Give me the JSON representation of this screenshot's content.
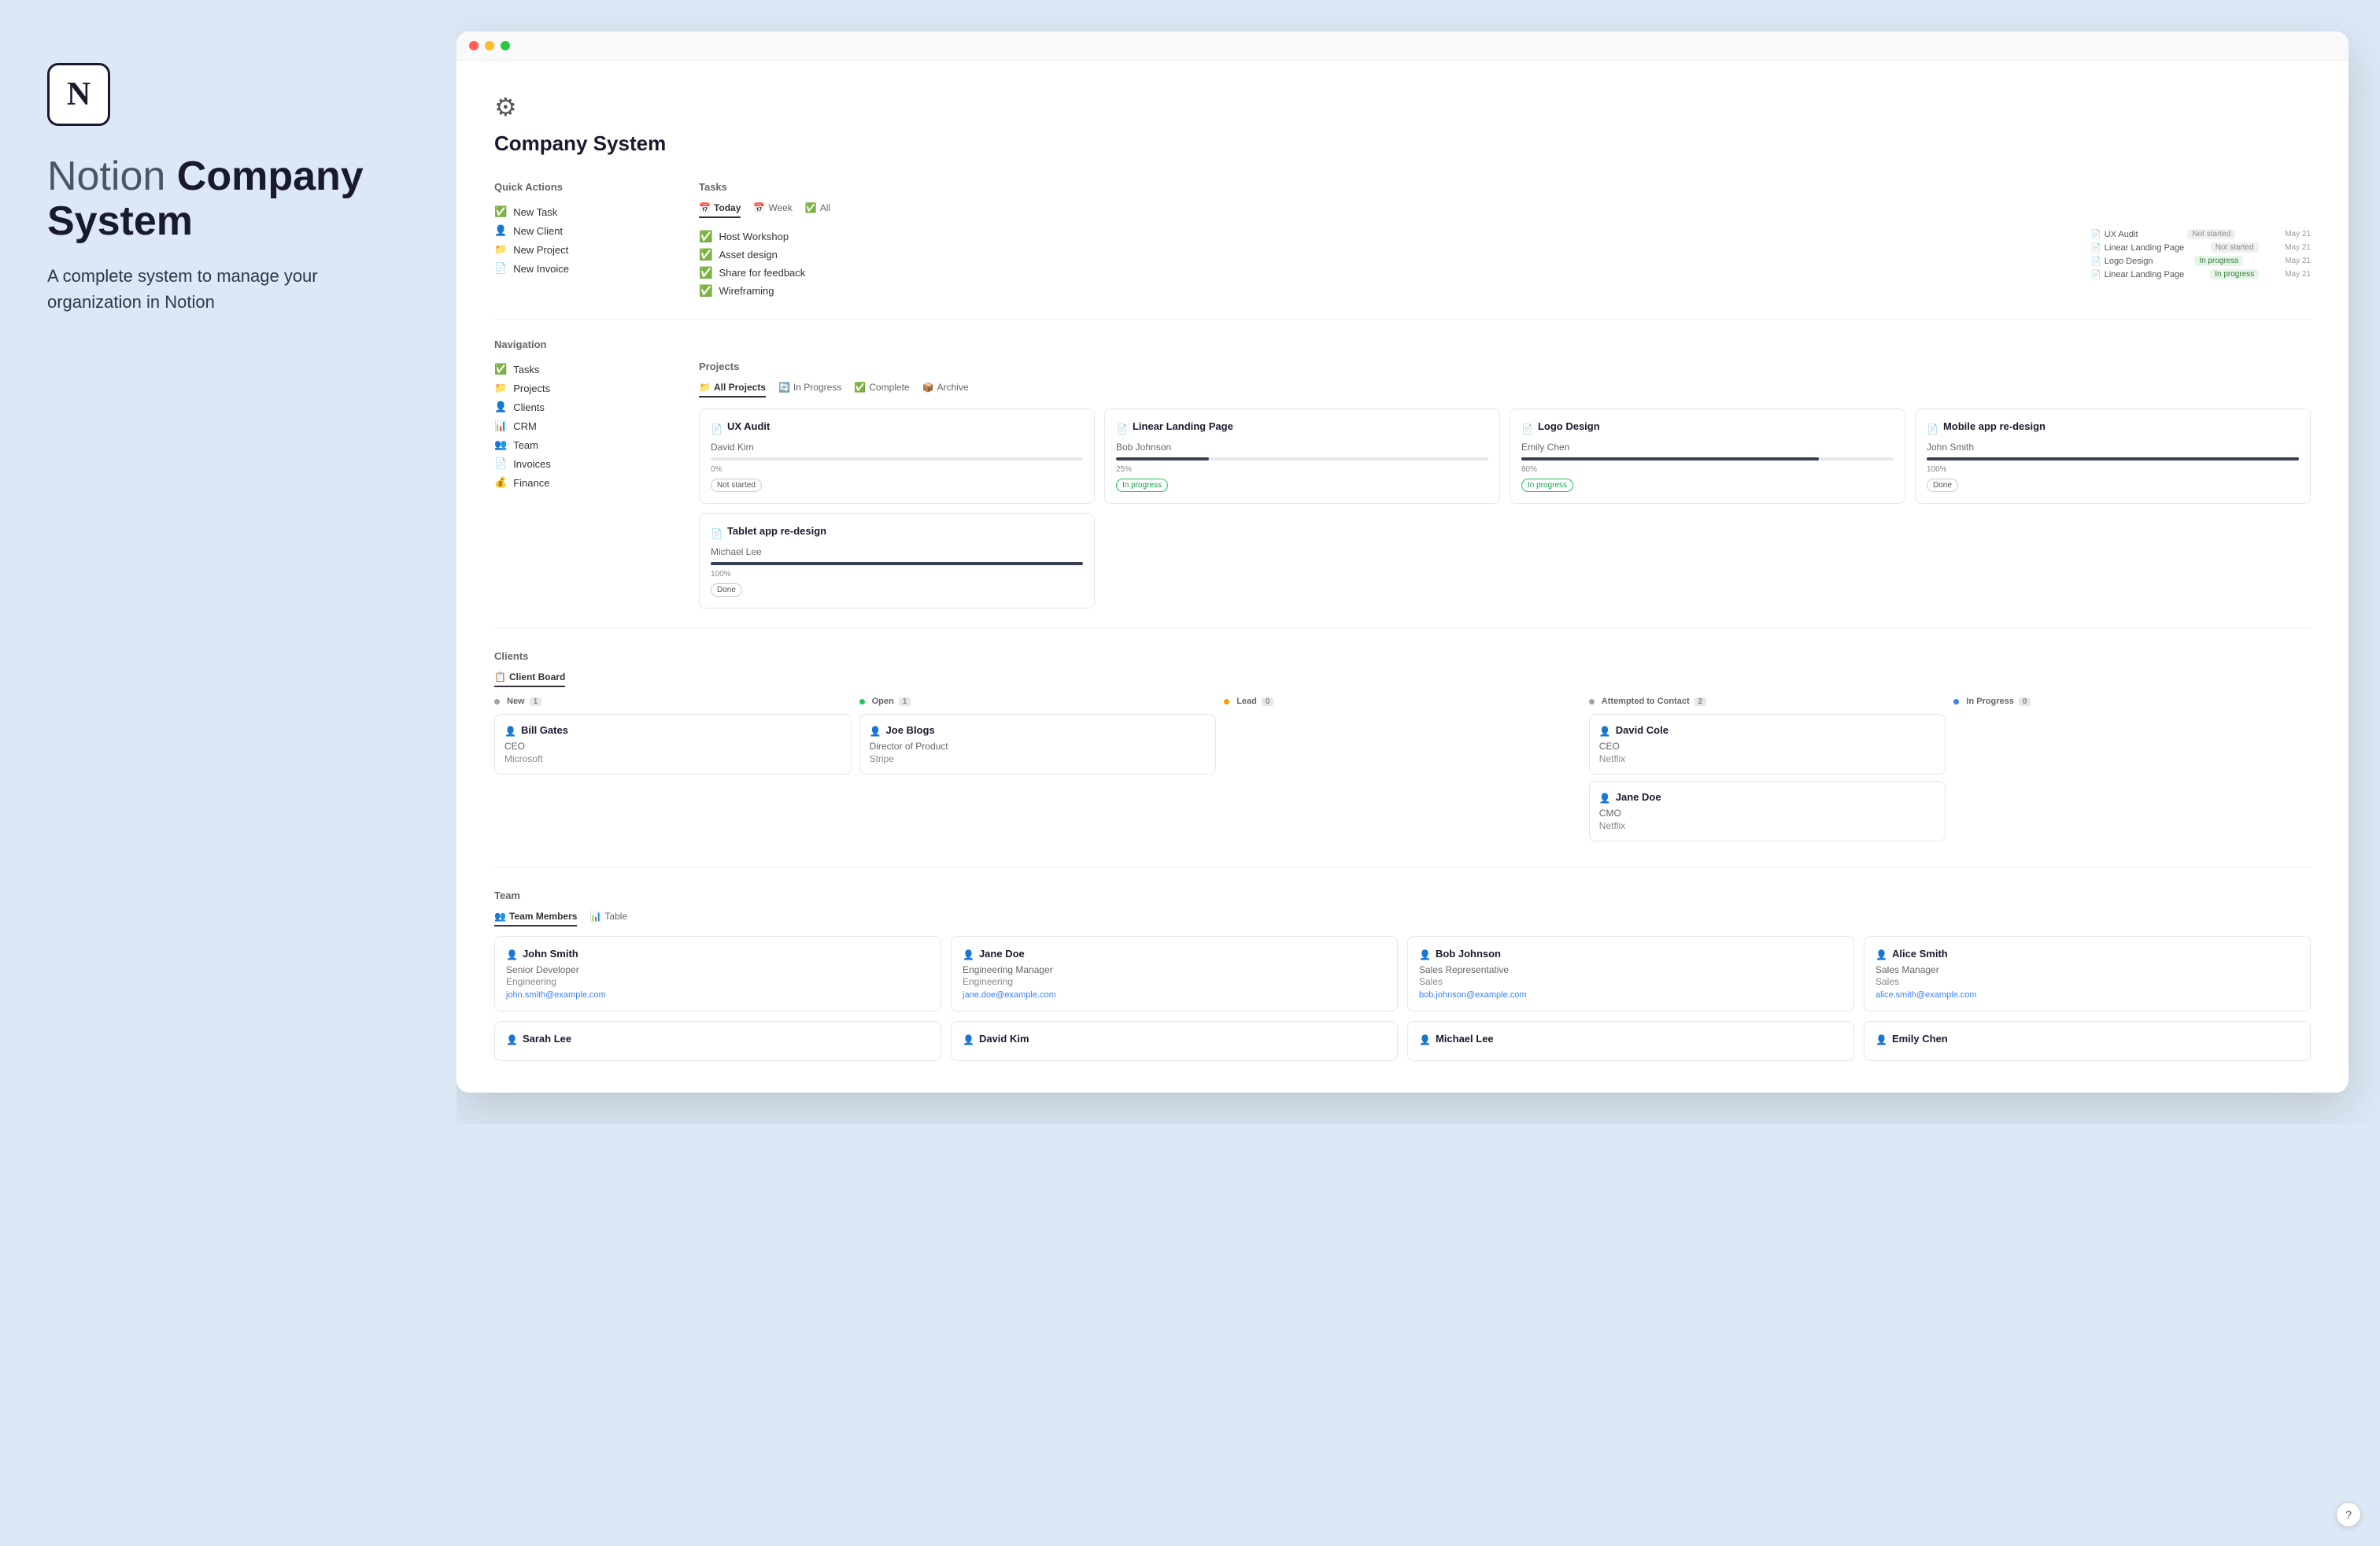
{
  "left": {
    "title_part1": "Notion",
    "title_part2": "Company System",
    "subtitle": "A complete system to manage your organization in Notion"
  },
  "page": {
    "title": "Company System",
    "gear_icon": "⚙"
  },
  "quick_actions": {
    "label": "Quick Actions",
    "items": [
      {
        "icon": "✅",
        "label": "New Task"
      },
      {
        "icon": "👤",
        "label": "New Client"
      },
      {
        "icon": "📁",
        "label": "New Project"
      },
      {
        "icon": "📄",
        "label": "New Invoice"
      }
    ]
  },
  "tasks": {
    "label": "Tasks",
    "tabs": [
      {
        "icon": "📅",
        "label": "Today",
        "active": true
      },
      {
        "icon": "📅",
        "label": "Week",
        "active": false
      },
      {
        "icon": "✅",
        "label": "All",
        "active": false
      }
    ],
    "items": [
      {
        "label": "Host Workshop",
        "checked": true
      },
      {
        "label": "Asset design",
        "checked": true
      },
      {
        "label": "Share for feedback",
        "checked": true
      },
      {
        "label": "Wireframing",
        "checked": true
      }
    ],
    "sidebar_items": [
      {
        "project": "UX Audit",
        "status": "Not started",
        "date": "May 21"
      },
      {
        "project": "Linear Landing Page",
        "status": "Not started",
        "date": "May 21"
      },
      {
        "project": "Logo Design",
        "status": "In progress",
        "date": "May 21"
      },
      {
        "project": "Linear Landing Page",
        "status": "In progress",
        "date": "May 21"
      }
    ]
  },
  "navigation": {
    "label": "Navigation",
    "items": [
      {
        "icon": "✅",
        "label": "Tasks"
      },
      {
        "icon": "📁",
        "label": "Projects"
      },
      {
        "icon": "👤",
        "label": "Clients"
      },
      {
        "icon": "📊",
        "label": "CRM"
      },
      {
        "icon": "👥",
        "label": "Team"
      },
      {
        "icon": "📄",
        "label": "Invoices"
      },
      {
        "icon": "💰",
        "label": "Finance"
      }
    ]
  },
  "projects": {
    "label": "Projects",
    "tabs": [
      {
        "icon": "📁",
        "label": "All Projects",
        "active": true
      },
      {
        "icon": "🔄",
        "label": "In Progress",
        "active": false
      },
      {
        "icon": "✅",
        "label": "Complete",
        "active": false
      },
      {
        "icon": "📦",
        "label": "Archive",
        "active": false
      }
    ],
    "items": [
      {
        "title": "UX Audit",
        "person": "David Kim",
        "progress": 0,
        "status": "Not started",
        "status_type": "notstarted"
      },
      {
        "title": "Linear Landing Page",
        "person": "Bob Johnson",
        "progress": 25,
        "status": "In progress",
        "status_type": "inprogress"
      },
      {
        "title": "Logo Design",
        "person": "Emily Chen",
        "progress": 80,
        "status": "In progress",
        "status_type": "inprogress"
      },
      {
        "title": "Mobile app re-design",
        "person": "John Smith",
        "progress": 100,
        "status": "Done",
        "status_type": "done"
      }
    ],
    "extra_items": [
      {
        "title": "Tablet app re-design",
        "person": "Michael Lee",
        "progress": 100,
        "status": "Done",
        "status_type": "done"
      }
    ]
  },
  "clients": {
    "label": "Clients",
    "tabs": [
      {
        "icon": "📋",
        "label": "Client Board",
        "active": true
      }
    ],
    "columns": [
      {
        "label": "New",
        "count": 1,
        "dot_color": "gray",
        "cards": [
          {
            "name": "Bill Gates",
            "role": "CEO",
            "company": "Microsoft"
          }
        ]
      },
      {
        "label": "Open",
        "count": 1,
        "dot_color": "green",
        "cards": [
          {
            "name": "Joe Blogs",
            "role": "Director of Product",
            "company": "Stripe"
          }
        ]
      },
      {
        "label": "Lead",
        "count": 0,
        "dot_color": "orange",
        "cards": []
      },
      {
        "label": "Attempted to Contact",
        "count": 2,
        "dot_color": "gray",
        "cards": [
          {
            "name": "David Cole",
            "role": "CEO",
            "company": "Netflix"
          },
          {
            "name": "Jane Doe",
            "role": "CMO",
            "company": "Netflix"
          }
        ]
      },
      {
        "label": "In Progress",
        "count": 0,
        "dot_color": "blue",
        "cards": []
      }
    ]
  },
  "team": {
    "label": "Team",
    "tabs": [
      {
        "icon": "👥",
        "label": "Team Members",
        "active": true
      },
      {
        "icon": "📊",
        "label": "Table",
        "active": false
      }
    ],
    "members": [
      {
        "name": "John Smith",
        "role": "Senior Developer",
        "dept": "Engineering",
        "email": "john.smith@example.com"
      },
      {
        "name": "Jane Doe",
        "role": "Engineering Manager",
        "dept": "Engineering",
        "email": "jane.doe@example.com"
      },
      {
        "name": "Bob Johnson",
        "role": "Sales Representative",
        "dept": "Sales",
        "email": "bob.johnson@example.com"
      },
      {
        "name": "Alice Smith",
        "role": "Sales Manager",
        "dept": "Sales",
        "email": "alice.smith@example.com"
      },
      {
        "name": "Sarah Lee",
        "role": "",
        "dept": "",
        "email": ""
      },
      {
        "name": "David Kim",
        "role": "",
        "dept": "",
        "email": ""
      },
      {
        "name": "Michael Lee",
        "role": "",
        "dept": "",
        "email": ""
      },
      {
        "name": "Emily Chen",
        "role": "",
        "dept": "",
        "email": ""
      }
    ]
  }
}
